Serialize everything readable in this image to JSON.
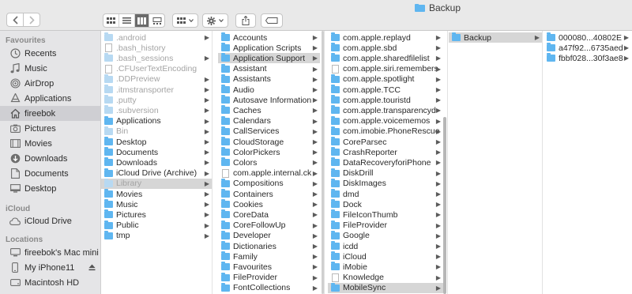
{
  "window_title": "Backup",
  "sidebar": {
    "favourites_header": "Favourites",
    "favourites": [
      {
        "label": "Recents",
        "icon": "clock-icon"
      },
      {
        "label": "Music",
        "icon": "music-note-icon"
      },
      {
        "label": "AirDrop",
        "icon": "airdrop-icon"
      },
      {
        "label": "Applications",
        "icon": "applications-icon"
      },
      {
        "label": "fireebok",
        "icon": "home-icon",
        "selected": true
      },
      {
        "label": "Pictures",
        "icon": "camera-icon"
      },
      {
        "label": "Movies",
        "icon": "film-icon"
      },
      {
        "label": "Downloads",
        "icon": "download-icon"
      },
      {
        "label": "Documents",
        "icon": "document-icon"
      },
      {
        "label": "Desktop",
        "icon": "desktop-icon"
      }
    ],
    "icloud_header": "iCloud",
    "icloud": [
      {
        "label": "iCloud Drive",
        "icon": "cloud-icon"
      }
    ],
    "locations_header": "Locations",
    "locations": [
      {
        "label": "fireebok's Mac mini",
        "icon": "computer-icon"
      },
      {
        "label": "My iPhone11",
        "icon": "phone-icon"
      },
      {
        "label": "Macintosh HD",
        "icon": "disk-icon"
      }
    ]
  },
  "columns": [
    {
      "items": [
        {
          "label": ".android",
          "type": "folder",
          "hidden": true,
          "arrow": true
        },
        {
          "label": ".bash_history",
          "type": "doc",
          "hidden": true
        },
        {
          "label": ".bash_sessions",
          "type": "folder",
          "hidden": true,
          "arrow": true
        },
        {
          "label": ".CFUserTextEncoding",
          "type": "doc",
          "hidden": true
        },
        {
          "label": ".DDPreview",
          "type": "folder",
          "hidden": true,
          "arrow": true
        },
        {
          "label": ".itmstransporter",
          "type": "folder",
          "hidden": true,
          "arrow": true
        },
        {
          "label": ".putty",
          "type": "folder",
          "hidden": true,
          "arrow": true
        },
        {
          "label": ".subversion",
          "type": "folder",
          "hidden": true,
          "arrow": true
        },
        {
          "label": "Applications",
          "type": "folder",
          "arrow": true
        },
        {
          "label": "Bin",
          "type": "folder",
          "hidden": true,
          "arrow": true
        },
        {
          "label": "Desktop",
          "type": "folder",
          "arrow": true
        },
        {
          "label": "Documents",
          "type": "folder",
          "arrow": true
        },
        {
          "label": "Downloads",
          "type": "folder",
          "arrow": true
        },
        {
          "label": "iCloud Drive (Archive)",
          "type": "folder",
          "arrow": true
        },
        {
          "label": "Library",
          "type": "folder",
          "hidden": true,
          "arrow": true,
          "selected": true
        },
        {
          "label": "Movies",
          "type": "folder",
          "arrow": true
        },
        {
          "label": "Music",
          "type": "folder",
          "arrow": true
        },
        {
          "label": "Pictures",
          "type": "folder",
          "arrow": true
        },
        {
          "label": "Public",
          "type": "folder",
          "arrow": true
        },
        {
          "label": "tmp",
          "type": "folder",
          "arrow": true
        }
      ]
    },
    {
      "items": [
        {
          "label": "Accounts",
          "type": "folder",
          "arrow": true
        },
        {
          "label": "Application Scripts",
          "type": "folder",
          "arrow": true
        },
        {
          "label": "Application Support",
          "type": "folder",
          "arrow": true,
          "selected": true
        },
        {
          "label": "Assistant",
          "type": "folder",
          "arrow": true
        },
        {
          "label": "Assistants",
          "type": "folder",
          "arrow": true
        },
        {
          "label": "Audio",
          "type": "folder",
          "arrow": true
        },
        {
          "label": "Autosave Information",
          "type": "folder",
          "arrow": true
        },
        {
          "label": "Caches",
          "type": "folder",
          "arrow": true
        },
        {
          "label": "Calendars",
          "type": "folder",
          "arrow": true
        },
        {
          "label": "CallServices",
          "type": "folder",
          "arrow": true
        },
        {
          "label": "CloudStorage",
          "type": "folder",
          "arrow": true
        },
        {
          "label": "ColorPickers",
          "type": "folder",
          "arrow": true
        },
        {
          "label": "Colors",
          "type": "folder",
          "arrow": true
        },
        {
          "label": "com.apple.internal.ck",
          "type": "doc",
          "arrow": true
        },
        {
          "label": "Compositions",
          "type": "folder",
          "arrow": true
        },
        {
          "label": "Containers",
          "type": "folder",
          "arrow": true
        },
        {
          "label": "Cookies",
          "type": "folder",
          "arrow": true
        },
        {
          "label": "CoreData",
          "type": "folder",
          "arrow": true
        },
        {
          "label": "CoreFollowUp",
          "type": "folder",
          "arrow": true
        },
        {
          "label": "Developer",
          "type": "folder",
          "arrow": true
        },
        {
          "label": "Dictionaries",
          "type": "folder",
          "arrow": true
        },
        {
          "label": "Family",
          "type": "folder",
          "arrow": true
        },
        {
          "label": "Favourites",
          "type": "folder",
          "arrow": true
        },
        {
          "label": "FileProvider",
          "type": "folder",
          "arrow": true
        },
        {
          "label": "FontCollections",
          "type": "folder",
          "arrow": true
        }
      ]
    },
    {
      "items": [
        {
          "label": "com.apple.replayd",
          "type": "folder",
          "arrow": true
        },
        {
          "label": "com.apple.sbd",
          "type": "folder",
          "arrow": true
        },
        {
          "label": "com.apple.sharedfilelist",
          "type": "folder",
          "arrow": true
        },
        {
          "label": "com.apple.siri.remembers",
          "type": "doc",
          "arrow": true
        },
        {
          "label": "com.apple.spotlight",
          "type": "folder",
          "arrow": true
        },
        {
          "label": "com.apple.TCC",
          "type": "folder",
          "arrow": true
        },
        {
          "label": "com.apple.touristd",
          "type": "folder",
          "arrow": true
        },
        {
          "label": "com.apple.transparencyd",
          "type": "folder",
          "arrow": true
        },
        {
          "label": "com.apple.voicememos",
          "type": "folder",
          "arrow": true
        },
        {
          "label": "com.imobie.PhoneRescue",
          "type": "folder",
          "arrow": true
        },
        {
          "label": "CoreParsec",
          "type": "folder",
          "arrow": true
        },
        {
          "label": "CrashReporter",
          "type": "folder",
          "arrow": true
        },
        {
          "label": "DataRecoveryforiPhone",
          "type": "folder",
          "arrow": true
        },
        {
          "label": "DiskDrill",
          "type": "folder",
          "arrow": true
        },
        {
          "label": "DiskImages",
          "type": "folder",
          "arrow": true
        },
        {
          "label": "dmd",
          "type": "folder",
          "arrow": true
        },
        {
          "label": "Dock",
          "type": "folder",
          "arrow": true
        },
        {
          "label": "FileIconThumb",
          "type": "folder",
          "arrow": true
        },
        {
          "label": "FileProvider",
          "type": "folder",
          "arrow": true
        },
        {
          "label": "Google",
          "type": "folder",
          "arrow": true
        },
        {
          "label": "icdd",
          "type": "folder",
          "arrow": true
        },
        {
          "label": "iCloud",
          "type": "folder",
          "arrow": true
        },
        {
          "label": "iMobie",
          "type": "folder",
          "arrow": true
        },
        {
          "label": "Knowledge",
          "type": "doc",
          "arrow": true
        },
        {
          "label": "MobileSync",
          "type": "folder",
          "arrow": true,
          "selected": true
        }
      ]
    },
    {
      "items": [
        {
          "label": "Backup",
          "type": "folder",
          "arrow": true,
          "selected": true
        }
      ]
    },
    {
      "items": [
        {
          "label": "000080...40802E",
          "type": "folder",
          "arrow": true
        },
        {
          "label": "a47f92...6735aed",
          "type": "folder",
          "arrow": true
        },
        {
          "label": "fbbf028...30f3ae8",
          "type": "folder",
          "arrow": true
        }
      ]
    }
  ],
  "colors": {
    "folder": "#5fb6f0",
    "selection": "#d6d6d6",
    "sidebar_bg": "#e5e5e7",
    "toolbar_bg": "#e9e9e9"
  }
}
